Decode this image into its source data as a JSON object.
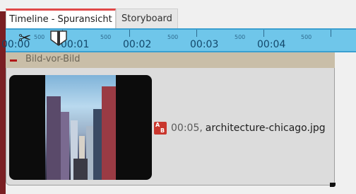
{
  "tabs": [
    {
      "label": "Timeline - Spuransicht",
      "active": true
    },
    {
      "label": "Storyboard",
      "active": false
    }
  ],
  "ruler": {
    "major_labels": [
      "00:00",
      "00:01",
      "00:02",
      "00:03",
      "00:04"
    ],
    "minor_label": "500"
  },
  "track": {
    "name": "Bild-vor-Bild",
    "clip": {
      "duration": "00:05,",
      "filename": "architecture-chicago.jpg",
      "icon": "image-ab-icon"
    }
  },
  "colors": {
    "ruler_bg": "#6fc6ea",
    "track_header": "#c9bea8",
    "accent_red": "#e04848"
  }
}
